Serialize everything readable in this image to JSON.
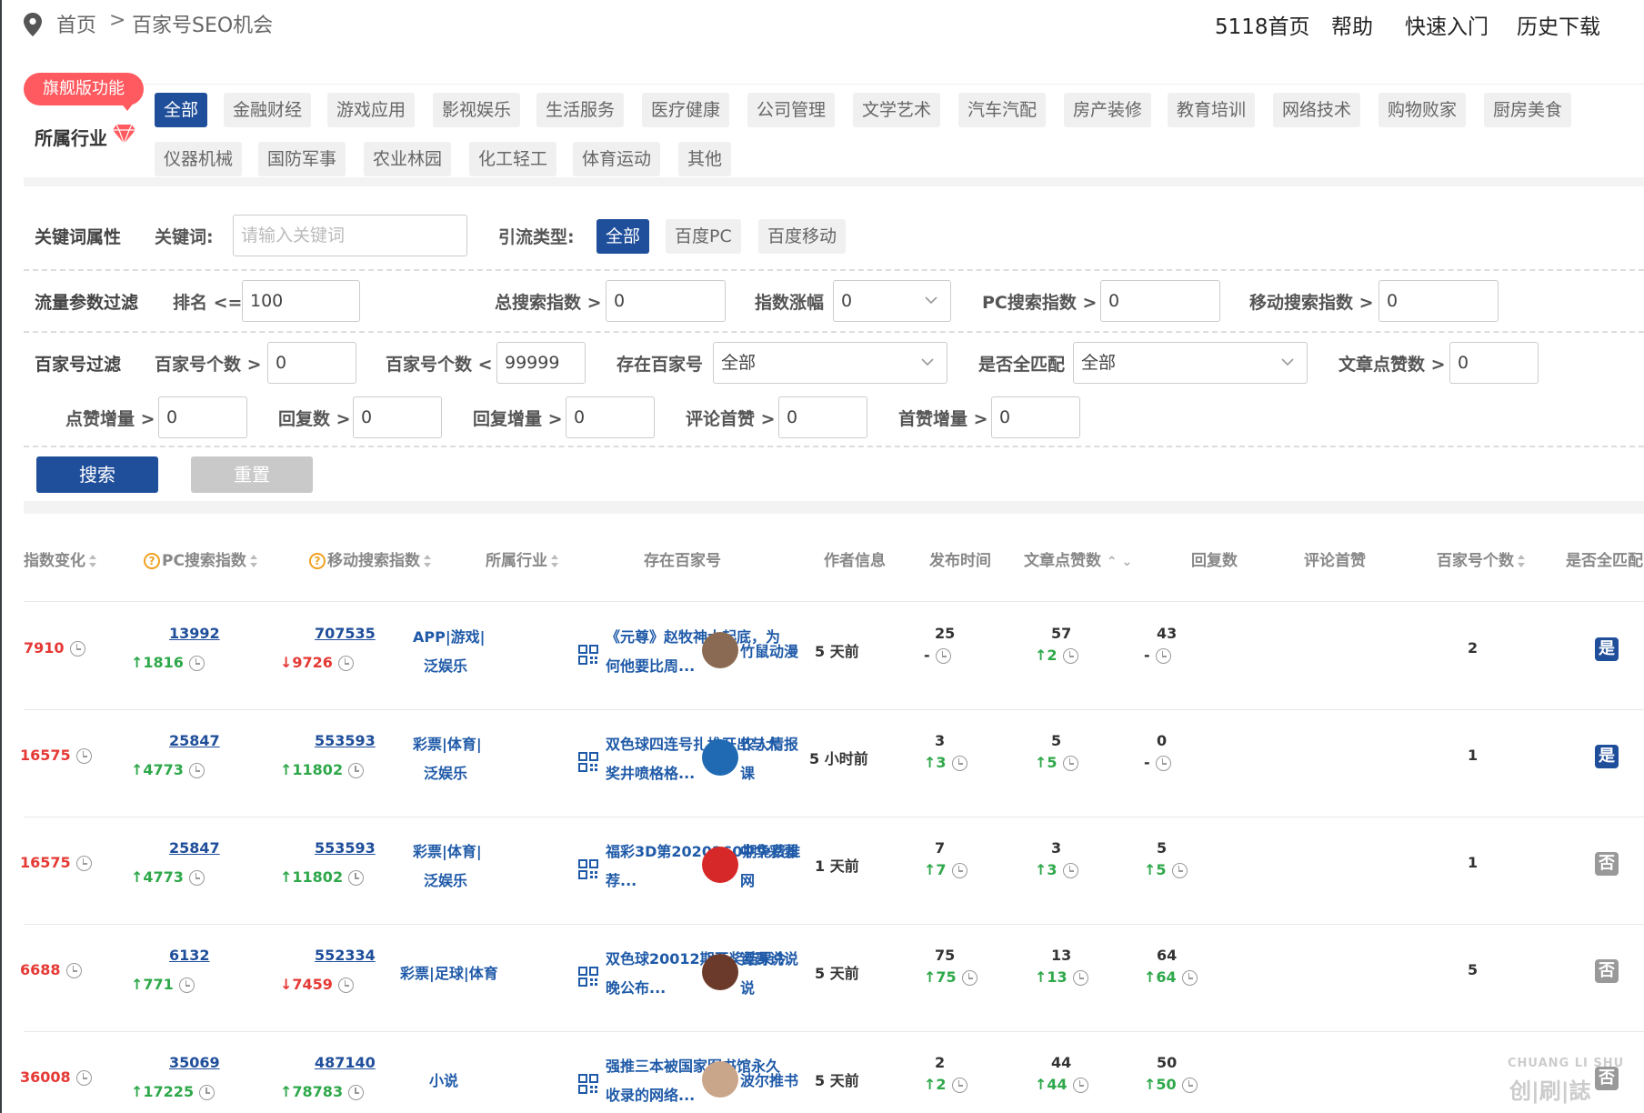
{
  "breadcrumb": {
    "home": "首页",
    "sep": ">",
    "current": "百家号SEO机会"
  },
  "topnav": [
    "5118首页",
    "帮助",
    "快速入门",
    "历史下载"
  ],
  "industry": {
    "flag": "旗舰版功能",
    "label": "所属行业",
    "tags_row1": [
      "全部",
      "金融财经",
      "游戏应用",
      "影视娱乐",
      "生活服务",
      "医疗健康",
      "公司管理",
      "文学艺术",
      "汽车汽配",
      "房产装修",
      "教育培训",
      "网络技术",
      "购物败家",
      "厨房美食"
    ],
    "tags_row2": [
      "仪器机械",
      "国防军事",
      "农业林园",
      "化工轻工",
      "体育运动",
      "其他"
    ],
    "active": "全部"
  },
  "keyword_attr": {
    "label": "关键词属性",
    "keyword_label": "关键词:",
    "keyword_placeholder": "请输入关键词",
    "traffic_type_label": "引流类型:",
    "traffic_types": [
      "全部",
      "百度PC",
      "百度移动"
    ]
  },
  "flow_filter": {
    "label": "流量参数过滤",
    "rank_label": "排名 <=",
    "rank_value": "100",
    "total_label": "总搜索指数 >",
    "total_value": "0",
    "change_label": "指数涨幅",
    "change_value": "0",
    "pc_label": "PC搜索指数 >",
    "pc_value": "0",
    "mobile_label": "移动搜索指数 >",
    "mobile_value": "0"
  },
  "bjh_filter": {
    "label": "百家号过滤",
    "count_gt_label": "百家号个数 >",
    "count_gt_value": "0",
    "count_lt_label": "百家号个数 <",
    "count_lt_value": "99999",
    "exists_label": "存在百家号",
    "exists_value": "全部",
    "match_label": "是否全匹配",
    "match_value": "全部",
    "likes_label": "文章点赞数 >",
    "likes_value": "0",
    "like_inc_label": "点赞增量 >",
    "like_inc_value": "0",
    "reply_label": "回复数 >",
    "reply_value": "0",
    "reply_inc_label": "回复增量 >",
    "reply_inc_value": "0",
    "top_like_label": "评论首赞 >",
    "top_like_value": "0",
    "top_inc_label": "首赞增量 >",
    "top_inc_value": "0"
  },
  "buttons": {
    "search": "搜索",
    "reset": "重置"
  },
  "table": {
    "headers": {
      "change": "指数变化",
      "pc": "PC搜索指数",
      "mobile": "移动搜索指数",
      "industry": "所属行业",
      "bjh": "存在百家号",
      "author": "作者信息",
      "time": "发布时间",
      "likes": "文章点赞数",
      "replies": "回复数",
      "top": "评论首赞",
      "count": "百家号个数",
      "match": "是否全匹配"
    },
    "rows": [
      {
        "change": "7910",
        "pc": "13992",
        "pc_delta": "1816",
        "pc_dir": "up",
        "mobile": "707535",
        "mobile_delta": "9726",
        "mobile_dir": "down",
        "industry1": "APP|游戏|",
        "industry2": "泛娱乐",
        "title1": "《元尊》赵牧神大起底，为",
        "title2": "何他要比周...",
        "author1": "竹鼠动漫",
        "author2": "",
        "time": "5 天前",
        "likes": "25",
        "likes_delta": "-",
        "replies": "57",
        "replies_delta": "2",
        "top": "43",
        "top_delta": "-",
        "count": "2",
        "match": "是",
        "match_yes": true,
        "avatar": "#8a6a52"
      },
      {
        "change": "16575",
        "pc": "25847",
        "pc_delta": "4773",
        "pc_dir": "up",
        "mobile": "553593",
        "mobile_delta": "11802",
        "mobile_dir": "up",
        "industry1": "彩票|体育|",
        "industry2": "泛娱乐",
        "title1": "双色球四连号扎堆开出与大",
        "title2": "奖井喷格格...",
        "author1": "农人情报",
        "author2": "课",
        "time": "5 小时前",
        "likes": "3",
        "likes_delta": "3",
        "replies": "5",
        "replies_delta": "5",
        "top": "0",
        "top_delta": "-",
        "count": "1",
        "match": "是",
        "match_yes": true,
        "avatar": "#1f6ab3"
      },
      {
        "change": "16575",
        "pc": "25847",
        "pc_delta": "4773",
        "pc_dir": "up",
        "mobile": "553593",
        "mobile_delta": "11802",
        "mobile_dir": "up",
        "industry1": "彩票|体育|",
        "industry2": "泛娱乐",
        "title1": "福彩3D第2020260期免费推",
        "title2": "荐...",
        "author1": "中华彩票",
        "author2": "网",
        "time": "1 天前",
        "likes": "7",
        "likes_delta": "7",
        "replies": "3",
        "replies_delta": "3",
        "top": "5",
        "top_delta": "5",
        "count": "1",
        "match": "否",
        "match_yes": false,
        "avatar": "#d62828"
      },
      {
        "change": "6688",
        "pc": "6132",
        "pc_delta": "771",
        "pc_dir": "up",
        "mobile": "552334",
        "mobile_delta": "7459",
        "mobile_dir": "down",
        "industry1": "彩票|足球|体育",
        "industry2": "",
        "title1": "双色球20012期开奖结果今",
        "title2": "晚公布...",
        "author1": "谭哥说说",
        "author2": "说",
        "time": "5 天前",
        "likes": "75",
        "likes_delta": "75",
        "replies": "13",
        "replies_delta": "13",
        "top": "64",
        "top_delta": "64",
        "count": "5",
        "match": "否",
        "match_yes": false,
        "avatar": "#6b3a2a"
      },
      {
        "change": "36008",
        "pc": "35069",
        "pc_delta": "17225",
        "pc_dir": "up",
        "mobile": "487140",
        "mobile_delta": "78783",
        "mobile_dir": "up",
        "industry1": "小说",
        "industry2": "",
        "title1": "强推三本被国家图书馆永久",
        "title2": "收录的网络...",
        "author1": "波尔推书",
        "author2": "",
        "time": "5 天前",
        "likes": "2",
        "likes_delta": "2",
        "replies": "44",
        "replies_delta": "44",
        "top": "50",
        "top_delta": "50",
        "count": "",
        "match": "否",
        "match_yes": false,
        "avatar": "#c9a58a"
      }
    ]
  },
  "watermark": {
    "main": "创|刷|誌",
    "sub": "CHUANG LI SHU"
  },
  "colors": {
    "primary": "#1f4e9a",
    "flag": "#ff5a5f",
    "up": "#2ea84a",
    "down": "#e53935"
  }
}
